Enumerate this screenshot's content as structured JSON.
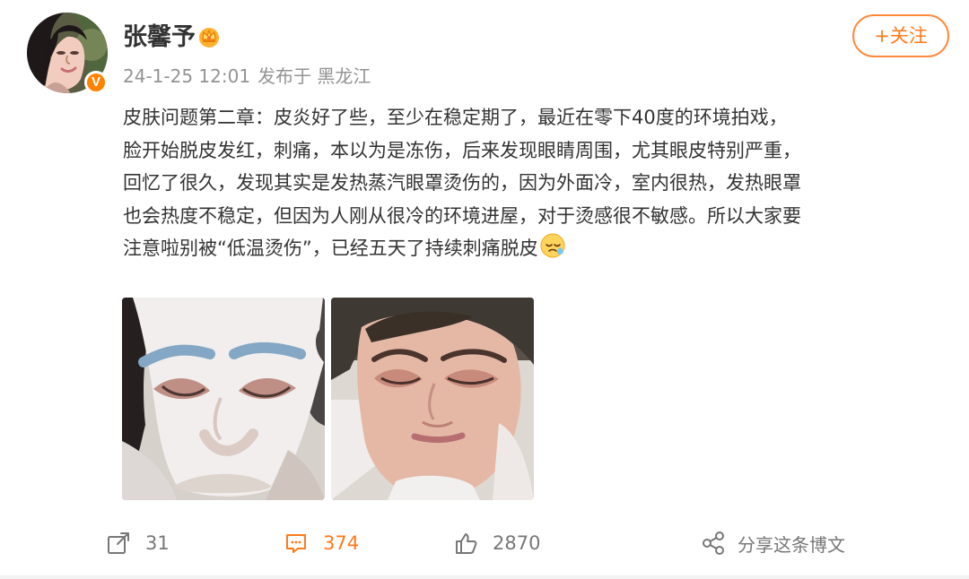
{
  "post": {
    "author": {
      "name": "张馨予",
      "avatar_icon": "person-avatar",
      "verified_icon": "verified-v-icon",
      "member_icon": "crown-icon"
    },
    "meta": {
      "time": "24-1-25 12:01",
      "location_label": "发布于 黑龙江"
    },
    "follow_button": "+关注",
    "text_lines": [
      "皮肤问题第二章：皮炎好了些，至少在稳定期了，最近在零下40度的环境拍戏，",
      "脸开始脱皮发红，刺痛，本以为是冻伤，后来发现眼睛周围，尤其眼皮特别严重，",
      "回忆了很久，发现其实是发热蒸汽眼罩烫伤的，因为外面冷，室内很热，发热眼罩",
      "也会热度不稳定，但因为人刚从很冷的环境进屋，对于烫感很不敏感。所以大家要",
      "注意啦别被“低温烫伤”，已经五天了持续刺痛脱皮"
    ],
    "emoji": "sleepy-face-emoji",
    "images": [
      {
        "description": "face-mask-photo"
      },
      {
        "description": "face-photo"
      }
    ],
    "actions": {
      "repost": "31",
      "comments": "374",
      "likes": "2870",
      "share": "分享这条博文"
    }
  },
  "colors": {
    "accent": "#ff7a1a",
    "verified": "#ff8200",
    "meta": "#939393",
    "text": "#333333"
  }
}
